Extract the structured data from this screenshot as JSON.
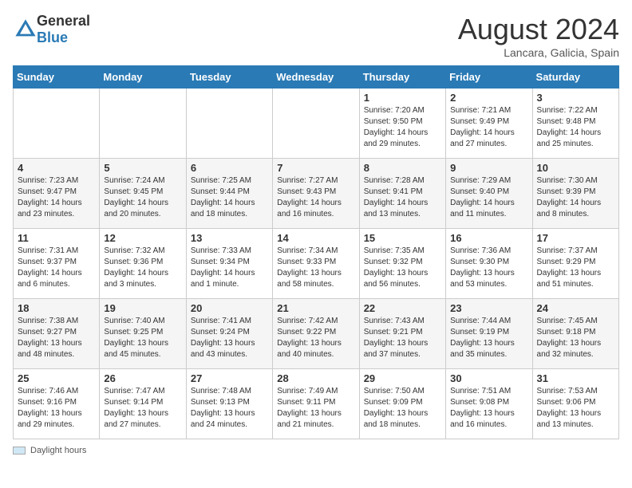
{
  "header": {
    "logo_general": "General",
    "logo_blue": "Blue",
    "month_title": "August 2024",
    "subtitle": "Lancara, Galicia, Spain"
  },
  "days_of_week": [
    "Sunday",
    "Monday",
    "Tuesday",
    "Wednesday",
    "Thursday",
    "Friday",
    "Saturday"
  ],
  "weeks": [
    [
      {
        "day": "",
        "info": ""
      },
      {
        "day": "",
        "info": ""
      },
      {
        "day": "",
        "info": ""
      },
      {
        "day": "",
        "info": ""
      },
      {
        "day": "1",
        "info": "Sunrise: 7:20 AM\nSunset: 9:50 PM\nDaylight: 14 hours\nand 29 minutes."
      },
      {
        "day": "2",
        "info": "Sunrise: 7:21 AM\nSunset: 9:49 PM\nDaylight: 14 hours\nand 27 minutes."
      },
      {
        "day": "3",
        "info": "Sunrise: 7:22 AM\nSunset: 9:48 PM\nDaylight: 14 hours\nand 25 minutes."
      }
    ],
    [
      {
        "day": "4",
        "info": "Sunrise: 7:23 AM\nSunset: 9:47 PM\nDaylight: 14 hours\nand 23 minutes."
      },
      {
        "day": "5",
        "info": "Sunrise: 7:24 AM\nSunset: 9:45 PM\nDaylight: 14 hours\nand 20 minutes."
      },
      {
        "day": "6",
        "info": "Sunrise: 7:25 AM\nSunset: 9:44 PM\nDaylight: 14 hours\nand 18 minutes."
      },
      {
        "day": "7",
        "info": "Sunrise: 7:27 AM\nSunset: 9:43 PM\nDaylight: 14 hours\nand 16 minutes."
      },
      {
        "day": "8",
        "info": "Sunrise: 7:28 AM\nSunset: 9:41 PM\nDaylight: 14 hours\nand 13 minutes."
      },
      {
        "day": "9",
        "info": "Sunrise: 7:29 AM\nSunset: 9:40 PM\nDaylight: 14 hours\nand 11 minutes."
      },
      {
        "day": "10",
        "info": "Sunrise: 7:30 AM\nSunset: 9:39 PM\nDaylight: 14 hours\nand 8 minutes."
      }
    ],
    [
      {
        "day": "11",
        "info": "Sunrise: 7:31 AM\nSunset: 9:37 PM\nDaylight: 14 hours\nand 6 minutes."
      },
      {
        "day": "12",
        "info": "Sunrise: 7:32 AM\nSunset: 9:36 PM\nDaylight: 14 hours\nand 3 minutes."
      },
      {
        "day": "13",
        "info": "Sunrise: 7:33 AM\nSunset: 9:34 PM\nDaylight: 14 hours\nand 1 minute."
      },
      {
        "day": "14",
        "info": "Sunrise: 7:34 AM\nSunset: 9:33 PM\nDaylight: 13 hours\nand 58 minutes."
      },
      {
        "day": "15",
        "info": "Sunrise: 7:35 AM\nSunset: 9:32 PM\nDaylight: 13 hours\nand 56 minutes."
      },
      {
        "day": "16",
        "info": "Sunrise: 7:36 AM\nSunset: 9:30 PM\nDaylight: 13 hours\nand 53 minutes."
      },
      {
        "day": "17",
        "info": "Sunrise: 7:37 AM\nSunset: 9:29 PM\nDaylight: 13 hours\nand 51 minutes."
      }
    ],
    [
      {
        "day": "18",
        "info": "Sunrise: 7:38 AM\nSunset: 9:27 PM\nDaylight: 13 hours\nand 48 minutes."
      },
      {
        "day": "19",
        "info": "Sunrise: 7:40 AM\nSunset: 9:25 PM\nDaylight: 13 hours\nand 45 minutes."
      },
      {
        "day": "20",
        "info": "Sunrise: 7:41 AM\nSunset: 9:24 PM\nDaylight: 13 hours\nand 43 minutes."
      },
      {
        "day": "21",
        "info": "Sunrise: 7:42 AM\nSunset: 9:22 PM\nDaylight: 13 hours\nand 40 minutes."
      },
      {
        "day": "22",
        "info": "Sunrise: 7:43 AM\nSunset: 9:21 PM\nDaylight: 13 hours\nand 37 minutes."
      },
      {
        "day": "23",
        "info": "Sunrise: 7:44 AM\nSunset: 9:19 PM\nDaylight: 13 hours\nand 35 minutes."
      },
      {
        "day": "24",
        "info": "Sunrise: 7:45 AM\nSunset: 9:18 PM\nDaylight: 13 hours\nand 32 minutes."
      }
    ],
    [
      {
        "day": "25",
        "info": "Sunrise: 7:46 AM\nSunset: 9:16 PM\nDaylight: 13 hours\nand 29 minutes."
      },
      {
        "day": "26",
        "info": "Sunrise: 7:47 AM\nSunset: 9:14 PM\nDaylight: 13 hours\nand 27 minutes."
      },
      {
        "day": "27",
        "info": "Sunrise: 7:48 AM\nSunset: 9:13 PM\nDaylight: 13 hours\nand 24 minutes."
      },
      {
        "day": "28",
        "info": "Sunrise: 7:49 AM\nSunset: 9:11 PM\nDaylight: 13 hours\nand 21 minutes."
      },
      {
        "day": "29",
        "info": "Sunrise: 7:50 AM\nSunset: 9:09 PM\nDaylight: 13 hours\nand 18 minutes."
      },
      {
        "day": "30",
        "info": "Sunrise: 7:51 AM\nSunset: 9:08 PM\nDaylight: 13 hours\nand 16 minutes."
      },
      {
        "day": "31",
        "info": "Sunrise: 7:53 AM\nSunset: 9:06 PM\nDaylight: 13 hours\nand 13 minutes."
      }
    ]
  ],
  "footer": {
    "legend_label": "Daylight hours"
  }
}
